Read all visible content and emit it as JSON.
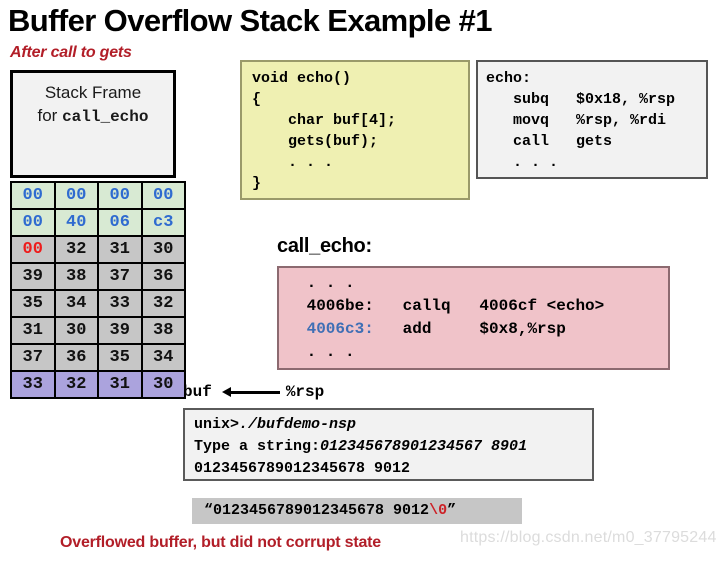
{
  "slide": {
    "title": "Buffer Overflow Stack Example #1",
    "after_call_label": "After call to gets",
    "bottom_caption": "Overflowed buffer, but did not corrupt state",
    "watermark": "https://blog.csdn.net/m0_37795244"
  },
  "stack_frame": {
    "line1": "Stack Frame",
    "line2_prefix": "for ",
    "line2_mono": "call_echo"
  },
  "byte_grid": {
    "rows": [
      {
        "style": "green",
        "cells": [
          {
            "text": "00",
            "color": "blue"
          },
          {
            "text": "00",
            "color": "blue"
          },
          {
            "text": "00",
            "color": "blue"
          },
          {
            "text": "00",
            "color": "blue"
          }
        ]
      },
      {
        "style": "green",
        "cells": [
          {
            "text": "00",
            "color": "blue"
          },
          {
            "text": "40",
            "color": "blue"
          },
          {
            "text": "06",
            "color": "blue"
          },
          {
            "text": "c3",
            "color": "blue"
          }
        ]
      },
      {
        "style": "gray",
        "cells": [
          {
            "text": "00",
            "color": "red"
          },
          {
            "text": "32",
            "color": "black"
          },
          {
            "text": "31",
            "color": "black"
          },
          {
            "text": "30",
            "color": "black"
          }
        ]
      },
      {
        "style": "gray",
        "cells": [
          {
            "text": "39",
            "color": "black"
          },
          {
            "text": "38",
            "color": "black"
          },
          {
            "text": "37",
            "color": "black"
          },
          {
            "text": "36",
            "color": "black"
          }
        ]
      },
      {
        "style": "gray",
        "cells": [
          {
            "text": "35",
            "color": "black"
          },
          {
            "text": "34",
            "color": "black"
          },
          {
            "text": "33",
            "color": "black"
          },
          {
            "text": "32",
            "color": "black"
          }
        ]
      },
      {
        "style": "gray",
        "cells": [
          {
            "text": "31",
            "color": "black"
          },
          {
            "text": "30",
            "color": "black"
          },
          {
            "text": "39",
            "color": "black"
          },
          {
            "text": "38",
            "color": "black"
          }
        ]
      },
      {
        "style": "gray",
        "cells": [
          {
            "text": "37",
            "color": "black"
          },
          {
            "text": "36",
            "color": "black"
          },
          {
            "text": "35",
            "color": "black"
          },
          {
            "text": "34",
            "color": "black"
          }
        ]
      },
      {
        "style": "purple",
        "cells": [
          {
            "text": "33",
            "color": "black"
          },
          {
            "text": "32",
            "color": "black"
          },
          {
            "text": "31",
            "color": "black"
          },
          {
            "text": "30",
            "color": "black"
          }
        ]
      }
    ]
  },
  "pointer": {
    "buf_label": "buf",
    "rsp_label": "%rsp",
    "arrow_icon": "left-arrow-icon"
  },
  "c_code": {
    "text": "void echo()\n{\n    char buf[4];\n    gets(buf);\n    . . .\n}"
  },
  "echo_asm": {
    "text": "echo:\n   subq   $0x18, %rsp\n   movq   %rsp, %rdi\n   call   gets\n   . . ."
  },
  "call_echo": {
    "heading": "call_echo:",
    "line_dots_top": " . . .",
    "line_callq_addr": " 4006be:",
    "line_callq_rest": "   callq   4006cf <echo>",
    "line_add_addr": " 4006c3:",
    "line_add_rest": "   add     $0x8,%rsp",
    "line_dots_bottom": " . . ."
  },
  "terminal": {
    "line1_prefix": "unix>",
    "line1_italic": "./bufdemo-nsp",
    "line2_prefix": "Type a string:",
    "line2_italic": "012345678901234567 8901",
    "line3": "0123456789012345678 9012"
  },
  "quoted_string": {
    "open_quote": "“",
    "body": "0123456789012345678 9012",
    "nul": "\\0",
    "close_quote": "”"
  }
}
